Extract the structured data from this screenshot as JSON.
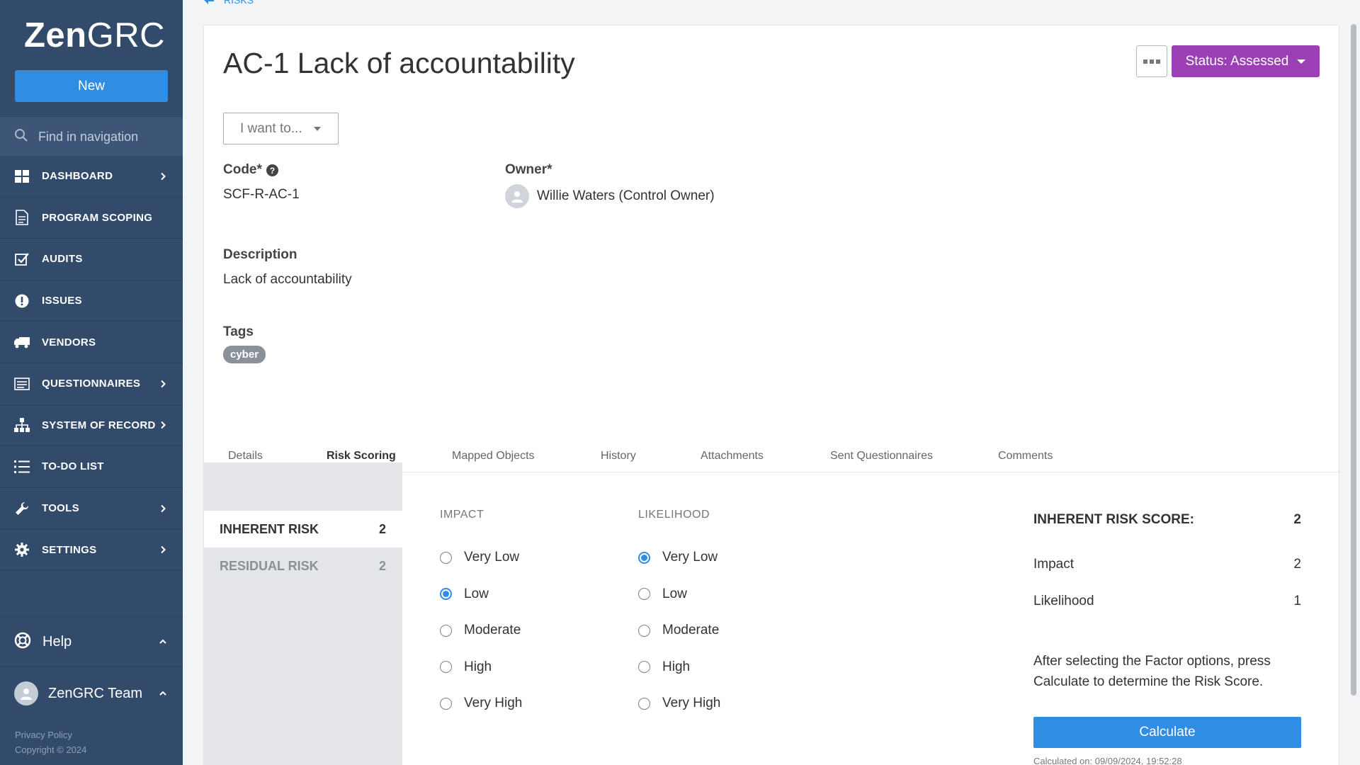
{
  "sidebar": {
    "logo_bold": "Zen",
    "logo_light": "GRC",
    "new_label": "New",
    "search_placeholder": "Find in navigation",
    "items": [
      {
        "label": "DASHBOARD",
        "icon": "dashboard-icon",
        "chevron": true
      },
      {
        "label": "PROGRAM SCOPING",
        "icon": "document-icon",
        "chevron": false
      },
      {
        "label": "AUDITS",
        "icon": "checkbox-icon",
        "chevron": false
      },
      {
        "label": "ISSUES",
        "icon": "exclamation-icon",
        "chevron": false
      },
      {
        "label": "VENDORS",
        "icon": "truck-icon",
        "chevron": false
      },
      {
        "label": "QUESTIONNAIRES",
        "icon": "list-form-icon",
        "chevron": true
      },
      {
        "label": "SYSTEM OF RECORD",
        "icon": "hierarchy-icon",
        "chevron": true
      },
      {
        "label": "TO-DO LIST",
        "icon": "todo-list-icon",
        "chevron": false
      },
      {
        "label": "TOOLS",
        "icon": "wrench-icon",
        "chevron": true
      },
      {
        "label": "SETTINGS",
        "icon": "gear-icon",
        "chevron": true
      }
    ],
    "help_label": "Help",
    "team_label": "ZenGRC Team",
    "privacy": "Privacy Policy",
    "copyright": "Copyright © 2024"
  },
  "breadcrumb": {
    "label": "RISKS"
  },
  "record": {
    "title": "AC-1 Lack of accountability",
    "status_label": "Status: Assessed",
    "i_want_label": "I want to...",
    "code_label": "Code*",
    "code_value": "SCF-R-AC-1",
    "owner_label": "Owner*",
    "owner_value": "Willie Waters (Control Owner)",
    "description_label": "Description",
    "description_value": "Lack of accountability",
    "tags_label": "Tags",
    "tags": [
      "cyber"
    ]
  },
  "tabs": [
    "Details",
    "Risk Scoring",
    "Mapped Objects",
    "History",
    "Attachments",
    "Sent Questionnaires",
    "Comments"
  ],
  "active_tab": "Risk Scoring",
  "risk_scoring": {
    "risks": [
      {
        "label": "INHERENT RISK",
        "value": "2",
        "active": true
      },
      {
        "label": "RESIDUAL RISK",
        "value": "2",
        "active": false
      }
    ],
    "impact_header": "IMPACT",
    "likelihood_header": "LIKELIHOOD",
    "options": [
      "Very Low",
      "Low",
      "Moderate",
      "High",
      "Very High"
    ],
    "impact_selected": "Low",
    "likelihood_selected": "Very Low",
    "score_label": "INHERENT RISK SCORE:",
    "score_value": "2",
    "impact_label": "Impact",
    "impact_value": "2",
    "likelihood_label": "Likelihood",
    "likelihood_value": "1",
    "note": "After selecting the Factor options, press Calculate to determine the Risk Score.",
    "calculate_label": "Calculate",
    "calculated_on": "Calculated on: 09/09/2024, 19:52:28"
  },
  "colors": {
    "sidebar_bg": "#324b6b",
    "primary": "#2f8ee3",
    "status": "#9b3fb5"
  }
}
